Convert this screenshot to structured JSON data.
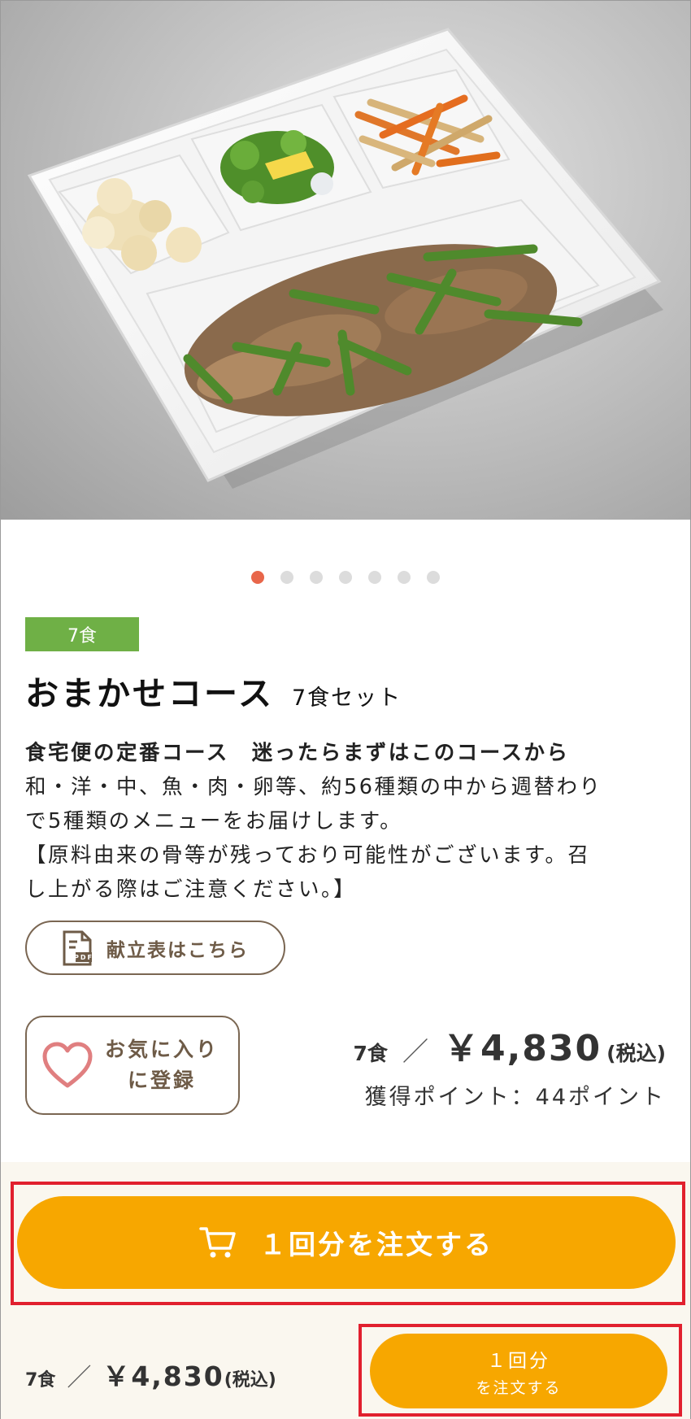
{
  "hero": {
    "image_icon": "bento-meal-photo",
    "slides_total": 7,
    "slide_active": 1
  },
  "product": {
    "badge": "7食",
    "title": "おまかせコース",
    "subtitle": "7食セット",
    "lead": "食宅便の定番コース　迷ったらまずはこのコースから",
    "desc_lines": [
      "和・洋・中、魚・肉・卵等、約56種類の中から週替わり",
      "で5種類のメニューをお届けします。",
      "【原料由来の骨等が残っており可能性がございます。召",
      "し上がる際はご注意ください。】"
    ]
  },
  "menu_button": {
    "label": "献立表はこちら",
    "icon": "pdf-document-icon"
  },
  "favorite_button": {
    "line1": "お気に入り",
    "line2": "に登録",
    "icon": "heart-icon"
  },
  "price": {
    "count": "7食",
    "slash": "／",
    "amount": "￥4,830",
    "tax": "(税込)",
    "points": "獲得ポイント：44ポイント"
  },
  "order_button": {
    "label": "１回分を注文する",
    "icon": "cart-icon"
  },
  "sticky": {
    "count": "7食",
    "slash": "／",
    "amount": "￥4,830",
    "tax": "(税込)",
    "button_line1": "１回分",
    "button_line2": "を注文する"
  },
  "colors": {
    "accent": "#f7a700",
    "badge": "#6fb046",
    "dot_active": "#e8664a",
    "highlight_frame": "#e1202e",
    "outline_brown": "#7a6652"
  }
}
